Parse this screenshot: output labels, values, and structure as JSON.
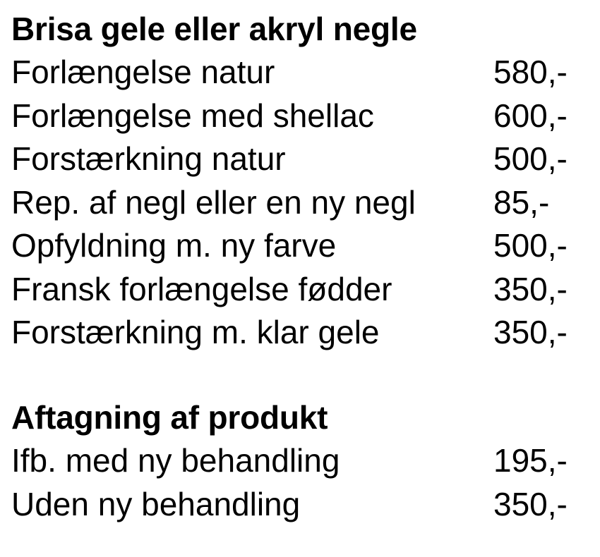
{
  "sections": [
    {
      "title": "Brisa gele eller akryl negle",
      "items": [
        {
          "name": "Forlængelse natur",
          "price": "580,-"
        },
        {
          "name": "Forlængelse med shellac",
          "price": "600,-"
        },
        {
          "name": "Forstærkning natur",
          "price": "500,-"
        },
        {
          "name": "Rep. af negl eller en ny negl",
          "price": "85,-"
        },
        {
          "name": "Opfyldning m. ny farve",
          "price": "500,-"
        },
        {
          "name": "Fransk forlængelse fødder",
          "price": "350,-"
        },
        {
          "name": "Forstærkning m. klar gele",
          "price": "350,-"
        }
      ]
    },
    {
      "title": "Aftagning af produkt",
      "items": [
        {
          "name": "Ifb. med ny behandling",
          "price": "195,-"
        },
        {
          "name": "Uden ny behandling",
          "price": "350,-"
        }
      ]
    }
  ]
}
